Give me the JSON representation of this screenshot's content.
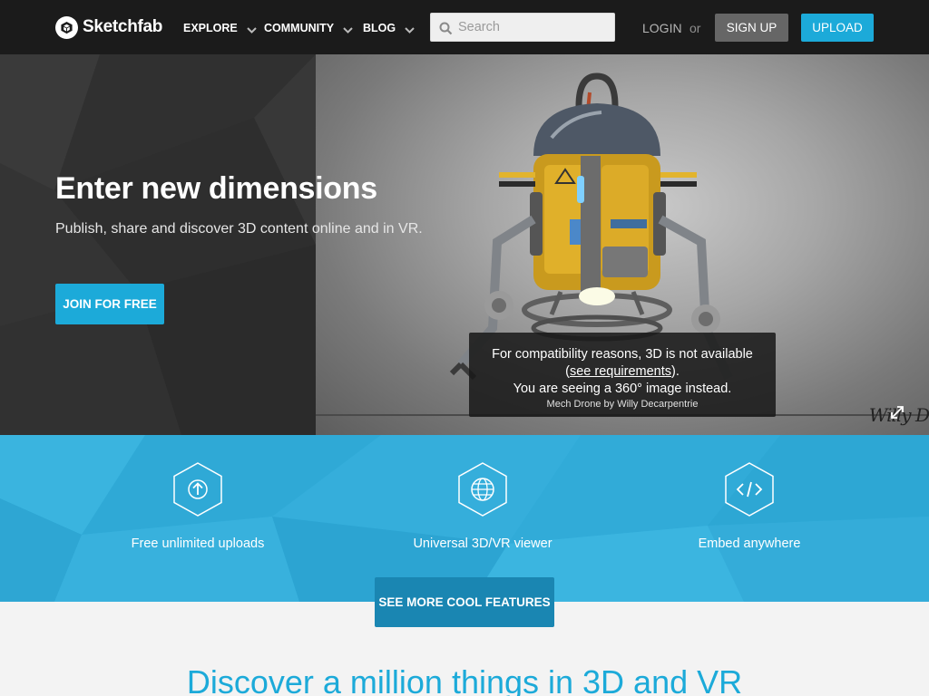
{
  "nav": {
    "logo_text": "Sketchfab",
    "menus": [
      {
        "label": "EXPLORE"
      },
      {
        "label": "COMMUNITY"
      },
      {
        "label": "BLOG"
      }
    ],
    "search_placeholder": "Search",
    "login_label": "LOGIN",
    "or_label": "or",
    "signup_label": "SIGN UP",
    "upload_label": "UPLOAD"
  },
  "hero": {
    "title": "Enter new dimensions",
    "subtitle": "Publish, share and discover 3D content online and in VR.",
    "cta_label": "JOIN FOR FREE",
    "notice": {
      "line1": "For compatibility reasons, 3D is not available",
      "link_open": "(",
      "link_text": "see requirements",
      "link_close": ").",
      "line3": "You are seeing a 360° image instead.",
      "credit": "Mech Drone by Willy Decarpentrie"
    },
    "signature": "Willy D"
  },
  "features": {
    "items": [
      {
        "label": "Free unlimited uploads",
        "icon": "upload-arrow-icon"
      },
      {
        "label": "Universal 3D/VR viewer",
        "icon": "globe-icon"
      },
      {
        "label": "Embed anywhere",
        "icon": "code-icon"
      }
    ],
    "more_label": "SEE MORE COOL FEATURES"
  },
  "discover": {
    "title": "Discover a million things in 3D and VR"
  },
  "colors": {
    "accent": "#1caad9",
    "nav_bg": "#1b1b1b",
    "features_bg": "#33aedb",
    "features_button": "#1a86b2"
  }
}
